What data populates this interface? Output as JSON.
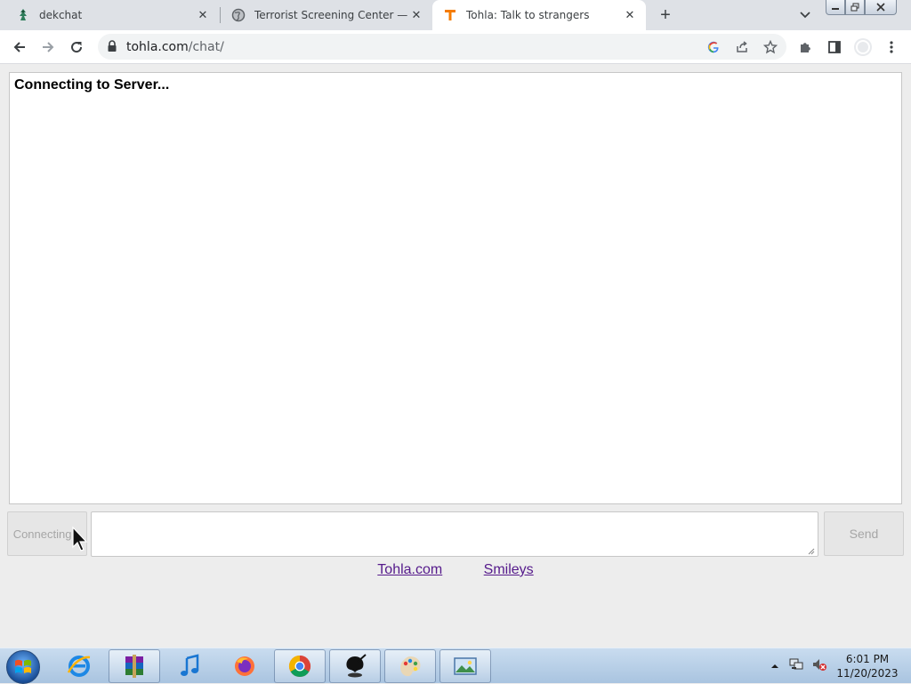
{
  "browser": {
    "tabs": [
      {
        "title": "dekchat",
        "active": false,
        "favicon": "dekchat-favicon"
      },
      {
        "title": "Terrorist Screening Center — FBI",
        "active": false,
        "favicon": "globe-icon"
      },
      {
        "title": "Tohla: Talk to strangers",
        "active": true,
        "favicon": "tohla-favicon"
      }
    ],
    "url_host": "tohla.com",
    "url_path": "/chat/"
  },
  "chat": {
    "status_text": "Connecting to Server...",
    "connect_button_label": "Connecting...",
    "send_button_label": "Send",
    "message_value": "",
    "links": [
      {
        "label": "Tohla.com"
      },
      {
        "label": "Smileys"
      }
    ]
  },
  "taskbar": {
    "time": "6:01 PM",
    "date": "11/20/2023",
    "apps": [
      "internet-explorer",
      "winrar",
      "itunes",
      "firefox",
      "chrome",
      "inkscape",
      "paint",
      "photo-viewer"
    ]
  },
  "colors": {
    "link": "#551a8b",
    "tab_strip": "#dee1e6",
    "tohla_orange": "#f57c00"
  }
}
